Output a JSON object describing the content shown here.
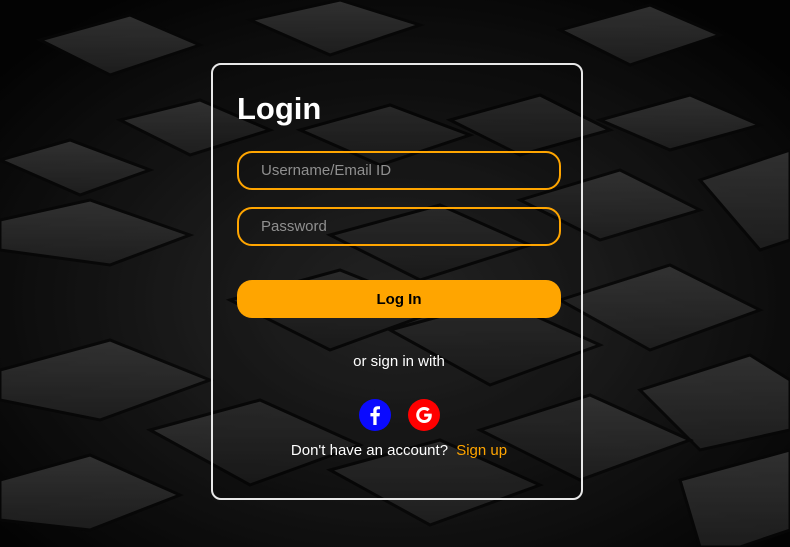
{
  "login": {
    "title": "Login",
    "username_placeholder": "Username/Email ID",
    "password_placeholder": "Password",
    "login_button": "Log In",
    "alt_signin_text": "or sign in with",
    "signup_prompt": "Don't have an account?",
    "signup_link": "Sign up"
  },
  "social": [
    {
      "icon": "facebook-icon",
      "color": "#0a0aff"
    },
    {
      "icon": "google-icon",
      "color": "#ff0000"
    }
  ],
  "theme": {
    "accent": "#ffa500",
    "background": "#0b0b0b",
    "text": "#ffffff"
  }
}
